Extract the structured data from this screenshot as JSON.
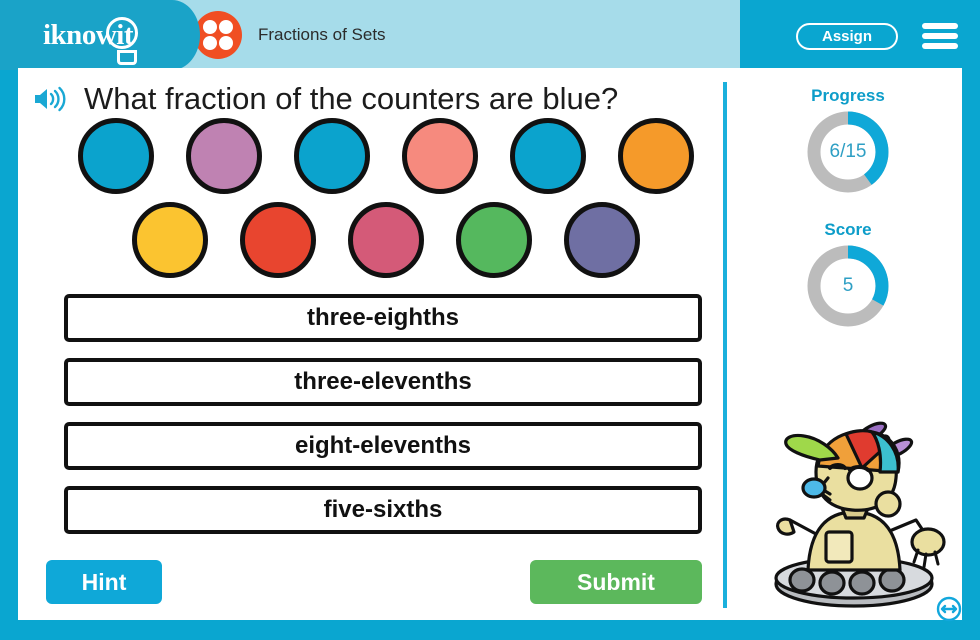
{
  "header": {
    "logo_text": "iknowit",
    "logo_icon": "lightbulb-icon",
    "topic_icon": "four-dot-counter-icon",
    "topic_title": "Fractions of Sets",
    "assign_label": "Assign",
    "menu_icon": "hamburger-menu-icon",
    "bar_color": "#0aa6d0",
    "logo_panel_color": "#1aa3c8",
    "title_panel_color": "#a6dcea",
    "topic_icon_color": "#f04e23"
  },
  "question": {
    "speaker_icon": "speaker-audio-icon",
    "text": "What fraction of the counters are blue?"
  },
  "counters": {
    "total": 11,
    "blue_count": 3,
    "rows": [
      [
        {
          "color": "#0ba3cd",
          "name": "blue"
        },
        {
          "color": "#bf82b2",
          "name": "mauve"
        },
        {
          "color": "#0ba3cd",
          "name": "blue"
        },
        {
          "color": "#f68a7e",
          "name": "salmon"
        },
        {
          "color": "#0ba3cd",
          "name": "blue"
        },
        {
          "color": "#f59a2a",
          "name": "orange"
        }
      ],
      [
        {
          "color": "#fbc430",
          "name": "yellow"
        },
        {
          "color": "#e8452f",
          "name": "red"
        },
        {
          "color": "#d45a78",
          "name": "pink"
        },
        {
          "color": "#55b85e",
          "name": "green"
        },
        {
          "color": "#6f6fa3",
          "name": "purple"
        }
      ]
    ]
  },
  "options": [
    {
      "label": "three-eighths"
    },
    {
      "label": "three-elevenths"
    },
    {
      "label": "eight-elevenths"
    },
    {
      "label": "five-sixths"
    }
  ],
  "actions": {
    "hint_label": "Hint",
    "hint_color": "#0fa8d8",
    "submit_label": "Submit",
    "submit_color": "#5cb85c"
  },
  "sidebar": {
    "progress": {
      "label": "Progress",
      "value": "6/15",
      "percent": 40,
      "arc_color": "#0fa8d8",
      "track_color": "#bcbcbc"
    },
    "score": {
      "label": "Score",
      "value": "5",
      "percent": 33,
      "arc_color": "#0fa8d8",
      "track_color": "#bcbcbc"
    },
    "mascot_icon": "robot-mascot-propeller-hat",
    "resize_icon": "resize-horizontal-icon"
  }
}
